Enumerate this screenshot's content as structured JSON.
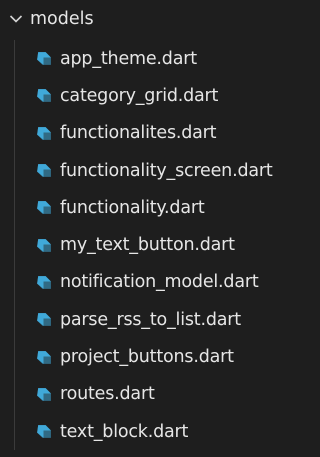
{
  "explorer": {
    "folder": {
      "label": "models",
      "expanded": true,
      "icon": "chevron-down-icon"
    },
    "file_icon": "dart-file-icon",
    "icon_color": "#40a9d9",
    "text_color": "#e6e6e6",
    "background": "#1e1e1e",
    "files": [
      {
        "label": "app_theme.dart"
      },
      {
        "label": "category_grid.dart"
      },
      {
        "label": "functionalites.dart"
      },
      {
        "label": "functionality_screen.dart"
      },
      {
        "label": "functionality.dart"
      },
      {
        "label": "my_text_button.dart"
      },
      {
        "label": "notification_model.dart"
      },
      {
        "label": "parse_rss_to_list.dart"
      },
      {
        "label": "project_buttons.dart"
      },
      {
        "label": "routes.dart"
      },
      {
        "label": "text_block.dart"
      }
    ]
  }
}
